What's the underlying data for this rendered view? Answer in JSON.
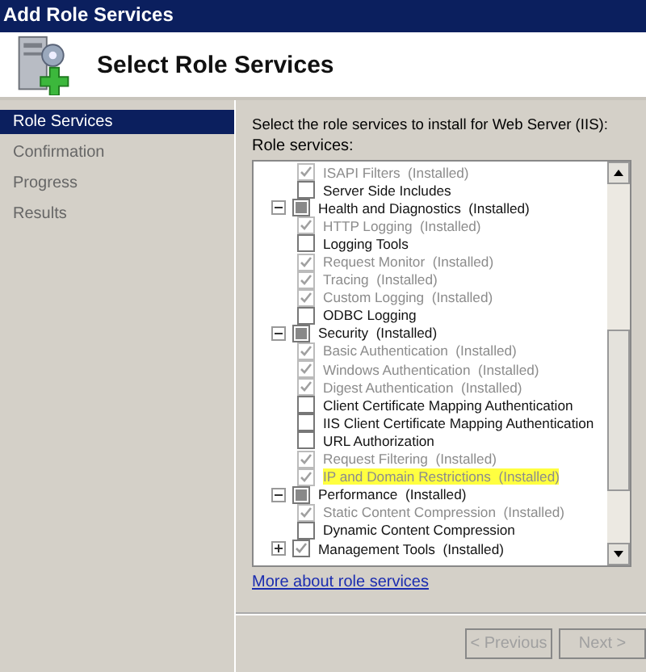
{
  "window": {
    "title": "Add Role Services"
  },
  "header": {
    "title": "Select Role Services"
  },
  "sidebar": {
    "items": [
      {
        "label": "Role Services",
        "selected": true
      },
      {
        "label": "Confirmation",
        "selected": false
      },
      {
        "label": "Progress",
        "selected": false
      },
      {
        "label": "Results",
        "selected": false
      }
    ]
  },
  "instruction": "Select the role services to install for Web Server (IIS):",
  "list_label": "Role services:",
  "tree": {
    "continued_items": [
      {
        "label": "ISAPI Filters",
        "status": "(Installed)",
        "checked": true,
        "disabled": true,
        "highlighted": false
      },
      {
        "label": "Server Side Includes",
        "checked": false,
        "disabled": false,
        "highlighted": false
      }
    ],
    "groups": [
      {
        "label": "Health and Diagnostics",
        "status": "(Installed)",
        "expanded": true,
        "checked": true,
        "partial": true,
        "children": [
          {
            "label": "HTTP Logging",
            "status": "(Installed)",
            "checked": true,
            "disabled": true,
            "highlighted": false
          },
          {
            "label": "Logging Tools",
            "checked": false,
            "disabled": false,
            "highlighted": false
          },
          {
            "label": "Request Monitor",
            "status": "(Installed)",
            "checked": true,
            "disabled": true,
            "highlighted": false
          },
          {
            "label": "Tracing",
            "status": "(Installed)",
            "checked": true,
            "disabled": true,
            "highlighted": false
          },
          {
            "label": "Custom Logging",
            "status": "(Installed)",
            "checked": true,
            "disabled": true,
            "highlighted": false
          },
          {
            "label": "ODBC Logging",
            "checked": false,
            "disabled": false,
            "highlighted": false
          }
        ]
      },
      {
        "label": "Security",
        "status": "(Installed)",
        "expanded": true,
        "checked": true,
        "partial": true,
        "children": [
          {
            "label": "Basic Authentication",
            "status": "(Installed)",
            "checked": true,
            "disabled": true,
            "highlighted": false
          },
          {
            "label": "Windows Authentication",
            "status": "(Installed)",
            "checked": true,
            "disabled": true,
            "highlighted": false
          },
          {
            "label": "Digest Authentication",
            "status": "(Installed)",
            "checked": true,
            "disabled": true,
            "highlighted": false
          },
          {
            "label": "Client Certificate Mapping Authentication",
            "checked": false,
            "disabled": false,
            "highlighted": false
          },
          {
            "label": "IIS Client Certificate Mapping Authentication",
            "checked": false,
            "disabled": false,
            "highlighted": false
          },
          {
            "label": "URL Authorization",
            "checked": false,
            "disabled": false,
            "highlighted": false
          },
          {
            "label": "Request Filtering",
            "status": "(Installed)",
            "checked": true,
            "disabled": true,
            "highlighted": false
          },
          {
            "label": "IP and Domain Restrictions",
            "status": "(Installed)",
            "checked": true,
            "disabled": true,
            "highlighted": true
          }
        ]
      },
      {
        "label": "Performance",
        "status": "(Installed)",
        "expanded": true,
        "checked": true,
        "partial": true,
        "children": [
          {
            "label": "Static Content Compression",
            "status": "(Installed)",
            "checked": true,
            "disabled": true,
            "highlighted": false
          },
          {
            "label": "Dynamic Content Compression",
            "checked": false,
            "disabled": false,
            "highlighted": false
          }
        ]
      },
      {
        "label": "Management Tools",
        "status": "(Installed)",
        "expanded": false,
        "checked": true,
        "partial": false
      }
    ]
  },
  "link": "More about role services",
  "buttons": [
    {
      "label": "< Previous",
      "disabled": true
    },
    {
      "label": "Next >",
      "disabled": true
    }
  ]
}
